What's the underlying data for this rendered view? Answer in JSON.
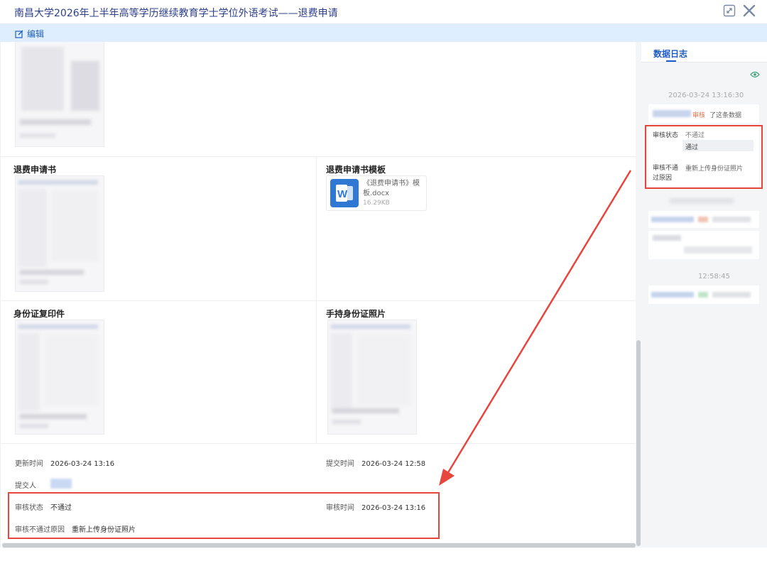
{
  "header": {
    "title": "南昌大学2026年上半年高等学历继续教育学士学位外语考试——退费申请",
    "toolbar_edit_label": "编辑"
  },
  "sections": {
    "refund_letter_label": "退费申请书",
    "template_label": "退费申请书模板",
    "id_copy_label": "身份证复印件",
    "handheld_id_label": "手持身份证照片"
  },
  "template_file": {
    "name": "《退费申请书》模板.docx",
    "size": "16.29KB",
    "icon": "word-doc-icon"
  },
  "details": {
    "updated_time_label": "更新时间",
    "updated_time": "2026-03-24 13:16",
    "submitted_time_label": "提交时间",
    "submitted_time": "2026-03-24 12:58",
    "submitter_label": "提交人",
    "review_status_label": "审核状态",
    "review_status": "不通过",
    "review_time_label": "审核时间",
    "review_time": "2026-03-24 13:16",
    "reject_reason_label": "审核不通过原因",
    "reject_reason": "重新上传身份证照片"
  },
  "side_panel": {
    "tab": "数据日志",
    "log1_time": "2026-03-24 13:16:30",
    "log1_action": "审核",
    "log1_suffix": "了这条数据",
    "log1_status_label": "审核状态",
    "log1_status_old": "不通过",
    "log1_status_new": "通过",
    "log1_reason_label": "审核不通过原因",
    "log1_reason": "重新上传身份证照片",
    "log3_time": "12:58:45"
  },
  "colors": {
    "accent": "#1e5bc6",
    "annotation_red": "#e8453c",
    "toolbar_bg": "#dfeefe"
  }
}
